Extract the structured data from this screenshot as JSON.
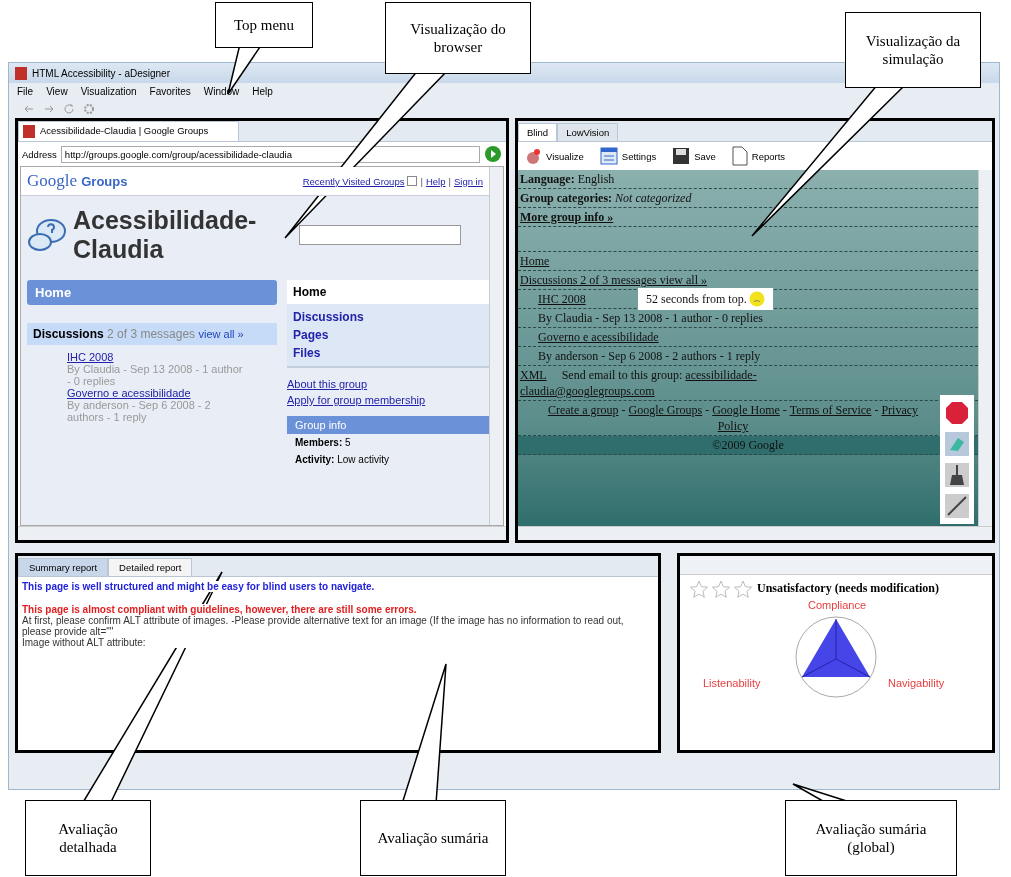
{
  "window": {
    "title": "HTML Accessibility - aDesigner"
  },
  "menu": [
    "File",
    "View",
    "Visualization",
    "Favorites",
    "Window",
    "Help"
  ],
  "browser": {
    "tab": "Acessibilidade-Claudia | Google Groups",
    "address_label": "Address",
    "address": "http://groups.google.com/group/acessibilidade-claudia",
    "page": {
      "logo": "Google",
      "logo_suffix": "Groups",
      "top_links": [
        "Recently Visited Groups",
        "Help",
        "Sign in"
      ],
      "top_link_separator": "|",
      "group_title": "Acessibilidade-Claudia",
      "home_bar": "Home",
      "discussions": {
        "title": "Discussions",
        "count": "2 of 3 messages",
        "view_all": "view all »",
        "items": [
          {
            "title": "IHC 2008",
            "meta": "By Claudia - Sep 13 2008 - 1 author - 0 replies"
          },
          {
            "title": "Governo e acessibilidade",
            "meta": "By anderson - Sep 6 2008 - 2 authors - 1 reply"
          }
        ]
      },
      "nav": [
        {
          "label": "Home",
          "selected": true
        },
        {
          "label": "Discussions",
          "selected": false
        },
        {
          "label": "Pages",
          "selected": false
        },
        {
          "label": "Files",
          "selected": false
        }
      ],
      "links": [
        "About this group",
        "Apply for group membership"
      ],
      "group_info": {
        "title": "Group info",
        "rows": [
          {
            "label": "Members:",
            "value": "5"
          },
          {
            "label": "Activity:",
            "value": "Low activity"
          }
        ]
      }
    }
  },
  "simulation": {
    "tabs": [
      {
        "label": "Blind",
        "selected": true
      },
      {
        "label": "LowVision",
        "selected": false
      }
    ],
    "toolbar": [
      {
        "kind": "visualize",
        "label": "Visualize"
      },
      {
        "kind": "settings",
        "label": "Settings"
      },
      {
        "kind": "save",
        "label": "Save"
      },
      {
        "kind": "reports",
        "label": "Reports"
      }
    ],
    "lines": [
      {
        "kind": "field",
        "label": "Language:",
        "value": "English"
      },
      {
        "kind": "field_italic",
        "label": "Group categories:",
        "value": "Not categorized"
      },
      {
        "kind": "bold",
        "text": "More group info »"
      },
      {
        "kind": "gap"
      },
      {
        "kind": "link",
        "text": "Home"
      },
      {
        "kind": "discussions",
        "label": "Discussions",
        "value": "2 of 3 messages",
        "link": "view all »"
      },
      {
        "kind": "item_link",
        "text": "IHC 2008"
      },
      {
        "kind": "item_text",
        "text": "By Claudia - Sep 13 2008 - 1 author - 0 replies"
      },
      {
        "kind": "item_link",
        "text": "Governo e acessibilidade"
      },
      {
        "kind": "item_text",
        "text": "By anderson - Sep 6 2008 - 2 authors - 1 reply"
      },
      {
        "kind": "email",
        "label": "XML",
        "text": "Send email to this group:",
        "link": "acessibilidade-claudia@googlegroups.com"
      },
      {
        "kind": "footer",
        "separator": "-",
        "links": [
          "Create a group",
          "Google Groups",
          "Google Home",
          "Terms of Service",
          "Privacy Policy"
        ]
      },
      {
        "kind": "copyright",
        "text": "©2009 Google"
      }
    ],
    "tooltip": "52 seconds from top."
  },
  "report": {
    "tabs": [
      {
        "label": "Summary report",
        "selected": true
      },
      {
        "label": "Detailed report",
        "selected": false
      }
    ],
    "messages": [
      {
        "kind": "info",
        "text": "This page is well structured and might be easy for blind users to navigate."
      },
      {
        "kind": "error",
        "text": "This page is almost compliant with guidelines, however, there are still some errors."
      },
      {
        "kind": "detail",
        "text": "At first, please confirm ALT attribute of images. -Please provide alternative text for an image (If the image has no information to read out, please provide alt=\"\""
      },
      {
        "kind": "detail",
        "text": "Image without ALT attribute:"
      }
    ]
  },
  "rating": {
    "stars": 0,
    "verdict": "Unsatisfactory (needs modification)",
    "axes": [
      "Compliance",
      "Navigability",
      "Listenability"
    ]
  },
  "callouts": [
    "Top menu",
    "Visualização do browser",
    "Visualização da simulação",
    "Avaliação detalhada",
    "Avaliação sumária",
    "Avaliação sumária  (global)"
  ]
}
